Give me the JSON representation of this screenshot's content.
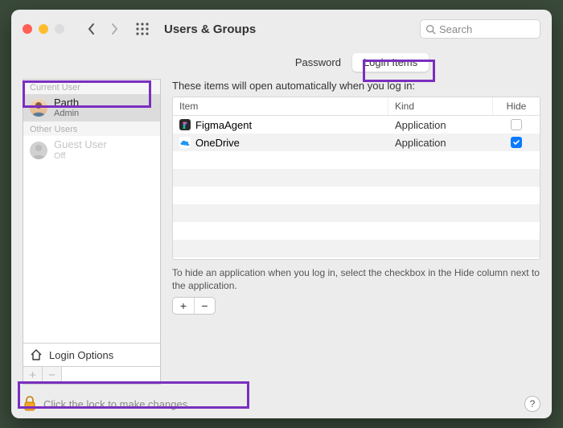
{
  "window": {
    "title": "Users & Groups"
  },
  "search": {
    "placeholder": "Search"
  },
  "sidebar": {
    "sections": [
      {
        "label": "Current User",
        "users": [
          {
            "name": "Parth",
            "role": "Admin"
          }
        ]
      },
      {
        "label": "Other Users",
        "users": [
          {
            "name": "Guest User",
            "role": "Off"
          }
        ]
      }
    ],
    "login_options": "Login Options"
  },
  "tabs": {
    "password": "Password",
    "login_items": "Login Items"
  },
  "main": {
    "desc": "These items will open automatically when you log in:",
    "columns": {
      "item": "Item",
      "kind": "Kind",
      "hide": "Hide"
    },
    "rows": [
      {
        "name": "FigmaAgent",
        "kind": "Application",
        "hide": false,
        "icon": "figma"
      },
      {
        "name": "OneDrive",
        "kind": "Application",
        "hide": true,
        "icon": "onedrive"
      }
    ],
    "hint": "To hide an application when you log in, select the checkbox in the Hide column next to the application."
  },
  "footer": {
    "lock_text": "Click the lock to make changes."
  },
  "glyphs": {
    "plus": "+",
    "minus": "−",
    "help": "?"
  }
}
